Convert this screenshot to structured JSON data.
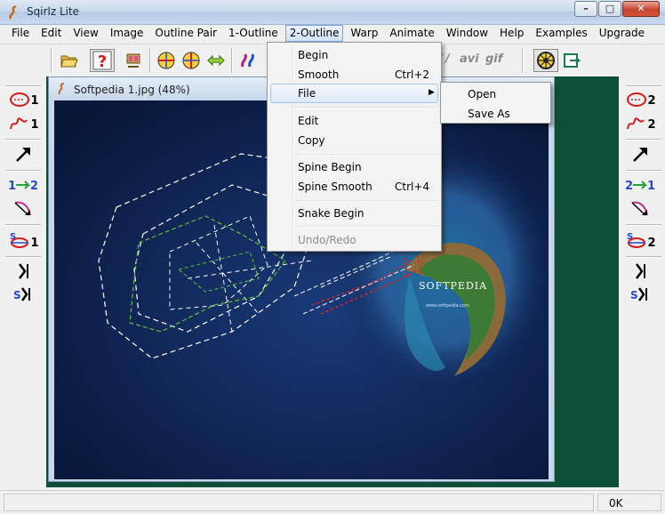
{
  "window": {
    "title": "Sqirlz Lite",
    "minimize_glyph": "–",
    "maximize_glyph": "□",
    "close_glyph": "✕"
  },
  "menubar": {
    "items": [
      "File",
      "Edit",
      "View",
      "Image",
      "Outline Pair",
      "1-Outline",
      "2-Outline",
      "Warp",
      "Animate",
      "Window",
      "Help",
      "Examples",
      "Upgrade"
    ],
    "active": "2-Outline"
  },
  "toolbar": {
    "buttons": [
      "open-folder-icon",
      "help-icon",
      "film-icon",
      "outline-pair-red-icon",
      "outline-pair-blue-icon",
      "warp-arrows-icon",
      "morph-icon",
      "point-icon"
    ],
    "export_labels": {
      "avi": "avi",
      "gif": "gif"
    },
    "trailing": [
      "film-reel-icon",
      "export-icon"
    ]
  },
  "left_palette": {
    "buttons": [
      {
        "icon": "red-outline-1-icon",
        "label": "1"
      },
      {
        "icon": "freehand-1-icon",
        "label": "1"
      },
      {
        "icon": "arrow-icon",
        "label": ""
      },
      {
        "icon": "copy-1-to-2-icon",
        "label": "1→2"
      },
      {
        "icon": "curve-icon",
        "label": ""
      },
      {
        "icon": "spine-1-icon",
        "label": "1"
      },
      {
        "icon": "snake-icon",
        "label": ""
      },
      {
        "icon": "spine-snake-icon",
        "label": "S"
      }
    ]
  },
  "right_palette": {
    "buttons": [
      {
        "icon": "red-outline-2-icon",
        "label": "2"
      },
      {
        "icon": "freehand-2-icon",
        "label": "2"
      },
      {
        "icon": "arrow-icon",
        "label": ""
      },
      {
        "icon": "copy-2-to-1-icon",
        "label": "2→1"
      },
      {
        "icon": "curve-icon",
        "label": ""
      },
      {
        "icon": "spine-2-icon",
        "label": "2"
      },
      {
        "icon": "snake-icon",
        "label": ""
      },
      {
        "icon": "spine-snake-icon",
        "label": "S"
      }
    ]
  },
  "document": {
    "title": "Softpedia 1.jpg  (48%)"
  },
  "image_text": {
    "watermark": "SOFTPEDIA",
    "url": "www.softpedia.com"
  },
  "dropdown": {
    "items": [
      {
        "label": "Begin",
        "shortcut": ""
      },
      {
        "label": "Smooth",
        "shortcut": "Ctrl+2"
      },
      {
        "label": "File",
        "shortcut": "",
        "submenu": true,
        "highlighted": true
      },
      {
        "label": "Edit",
        "shortcut": ""
      },
      {
        "label": "Copy",
        "shortcut": ""
      },
      {
        "label": "Spine Begin",
        "shortcut": ""
      },
      {
        "label": "Spine Smooth",
        "shortcut": "Ctrl+4"
      },
      {
        "label": "Snake Begin",
        "shortcut": ""
      },
      {
        "label": "Undo/Redo",
        "shortcut": "",
        "disabled": true
      }
    ]
  },
  "submenu": {
    "items": [
      "Open",
      "Save As"
    ]
  },
  "status": {
    "left": "",
    "right": "0K"
  },
  "colors": {
    "mdi_background": "#0d4f36",
    "outline_white": "#ffffff",
    "outline_green": "#5fbf3a",
    "outline_red": "#e02020"
  }
}
